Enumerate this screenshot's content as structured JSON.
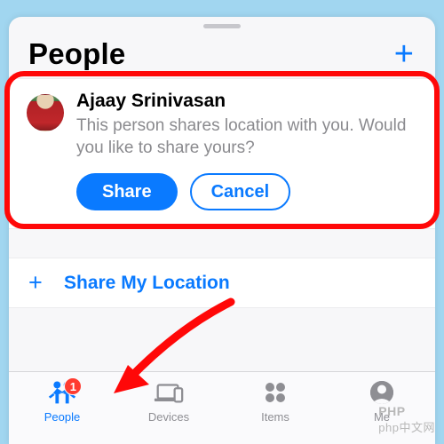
{
  "header": {
    "title": "People",
    "add_icon": "+"
  },
  "contact": {
    "name": "Ajaay Srinivasan",
    "message": "This person shares location with you. Would you like to share yours?",
    "share_label": "Share",
    "cancel_label": "Cancel"
  },
  "share_row": {
    "plus": "+",
    "label": "Share My Location"
  },
  "tabs": {
    "people": {
      "label": "People",
      "badge": "1",
      "active": true
    },
    "devices": {
      "label": "Devices"
    },
    "items": {
      "label": "Items"
    },
    "me": {
      "label": "Me"
    }
  },
  "watermark": {
    "line1": "PHP",
    "line2": "php中文网"
  }
}
